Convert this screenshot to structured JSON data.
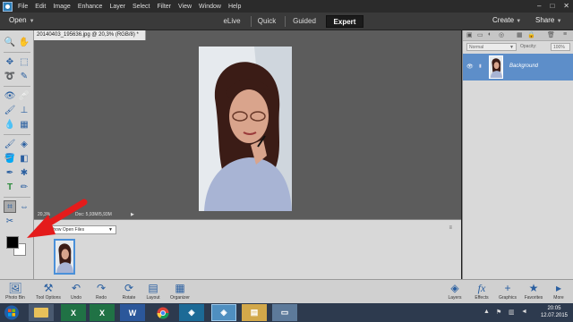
{
  "menubar": {
    "items": [
      "File",
      "Edit",
      "Image",
      "Enhance",
      "Layer",
      "Select",
      "Filter",
      "View",
      "Window",
      "Help"
    ],
    "window_controls": [
      "–",
      "□",
      "✕"
    ]
  },
  "modebar": {
    "open_label": "Open",
    "tabs": [
      {
        "label": "eLive",
        "active": false
      },
      {
        "label": "Quick",
        "active": false
      },
      {
        "label": "Guided",
        "active": false
      },
      {
        "label": "Expert",
        "active": true
      }
    ],
    "create_label": "Create",
    "share_label": "Share"
  },
  "document": {
    "tab_title": "20140403_195636.jpg @ 20,3% (RGB/8) *",
    "zoom": "20,3%",
    "doc_info": "Doc: 5,93M/5,93M"
  },
  "photobin": {
    "source_select": "Show Open Files",
    "menu_icon": "≡"
  },
  "layers_panel": {
    "blend_mode": "Normal",
    "opacity_label": "Opacity:",
    "opacity_value": "100%",
    "layer_name": "Background"
  },
  "taskbar_left": [
    {
      "label": "Photo Bin",
      "icon": "image-icon"
    },
    {
      "label": "Tool Options",
      "icon": "tools-icon"
    },
    {
      "label": "Undo",
      "icon": "undo-icon"
    },
    {
      "label": "Redo",
      "icon": "redo-icon"
    },
    {
      "label": "Rotate",
      "icon": "rotate-icon"
    },
    {
      "label": "Layout",
      "icon": "layout-icon"
    },
    {
      "label": "Organizer",
      "icon": "organizer-icon"
    }
  ],
  "taskbar_right": [
    {
      "label": "Layers",
      "icon": "layers-icon"
    },
    {
      "label": "Effects",
      "icon": "fx-icon"
    },
    {
      "label": "Graphics",
      "icon": "plus-icon"
    },
    {
      "label": "Favorites",
      "icon": "star-icon"
    },
    {
      "label": "More",
      "icon": "more-icon"
    }
  ],
  "windows_taskbar": {
    "time": "20:05",
    "date": "12.07.2015"
  },
  "colors": {
    "accent_blue": "#5d8ec9",
    "annotation_red": "#e41b1b",
    "dark_bar": "#2b2b2b"
  }
}
